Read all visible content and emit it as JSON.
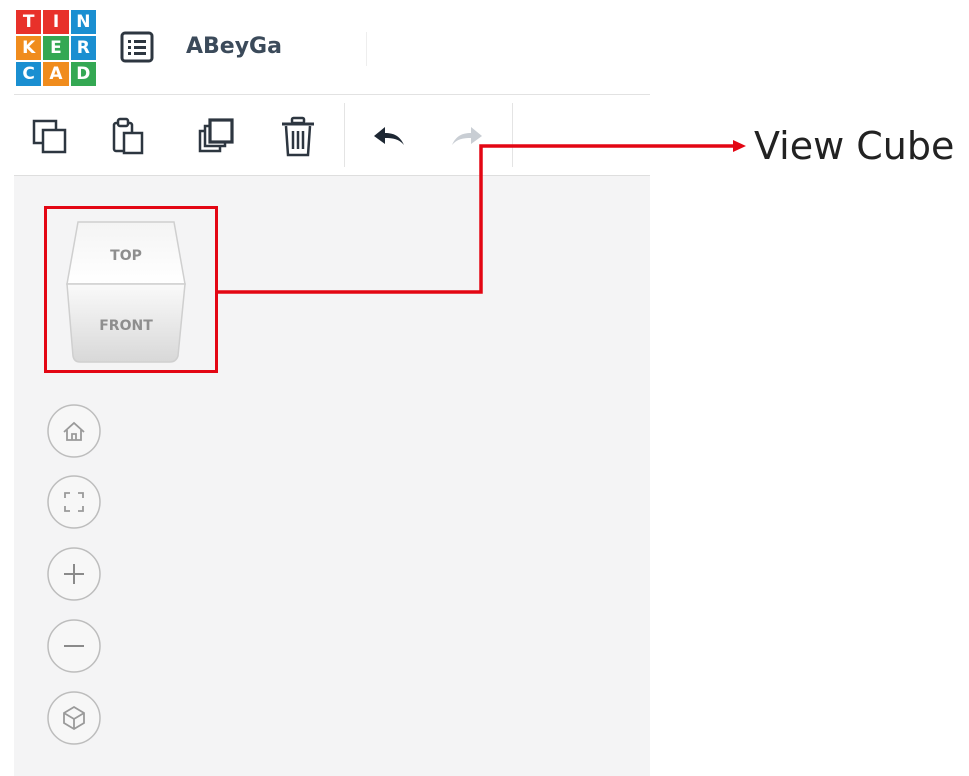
{
  "logo": {
    "letters": [
      "T",
      "I",
      "N",
      "K",
      "E",
      "R",
      "C",
      "A",
      "D"
    ],
    "colors": [
      "#e8312a",
      "#e8312a",
      "#1a8fd1",
      "#f08c1d",
      "#34a853",
      "#1a8fd1",
      "#1a8fd1",
      "#f08c1d",
      "#34a853"
    ]
  },
  "header": {
    "design_title": "ABeyGa",
    "menu_icon": "list-icon"
  },
  "toolbar": {
    "items": [
      {
        "name": "copy",
        "icon": "copy-icon"
      },
      {
        "name": "paste",
        "icon": "paste-icon"
      },
      {
        "name": "duplicate",
        "icon": "duplicate-icon"
      },
      {
        "name": "delete",
        "icon": "trash-icon"
      },
      {
        "name": "undo",
        "icon": "undo-arrow-icon"
      },
      {
        "name": "redo",
        "icon": "redo-arrow-icon",
        "disabled": true
      }
    ]
  },
  "view_cube": {
    "top_label": "TOP",
    "front_label": "FRONT"
  },
  "nav_controls": [
    {
      "name": "home-view",
      "icon": "home-icon"
    },
    {
      "name": "fit-all",
      "icon": "fit-to-view-icon"
    },
    {
      "name": "zoom-in",
      "icon": "plus-icon"
    },
    {
      "name": "zoom-out",
      "icon": "minus-icon"
    },
    {
      "name": "ortho-perspective",
      "icon": "cube-perspective-icon"
    }
  ],
  "annotation": {
    "label": "View Cube",
    "color": "#e30613"
  }
}
